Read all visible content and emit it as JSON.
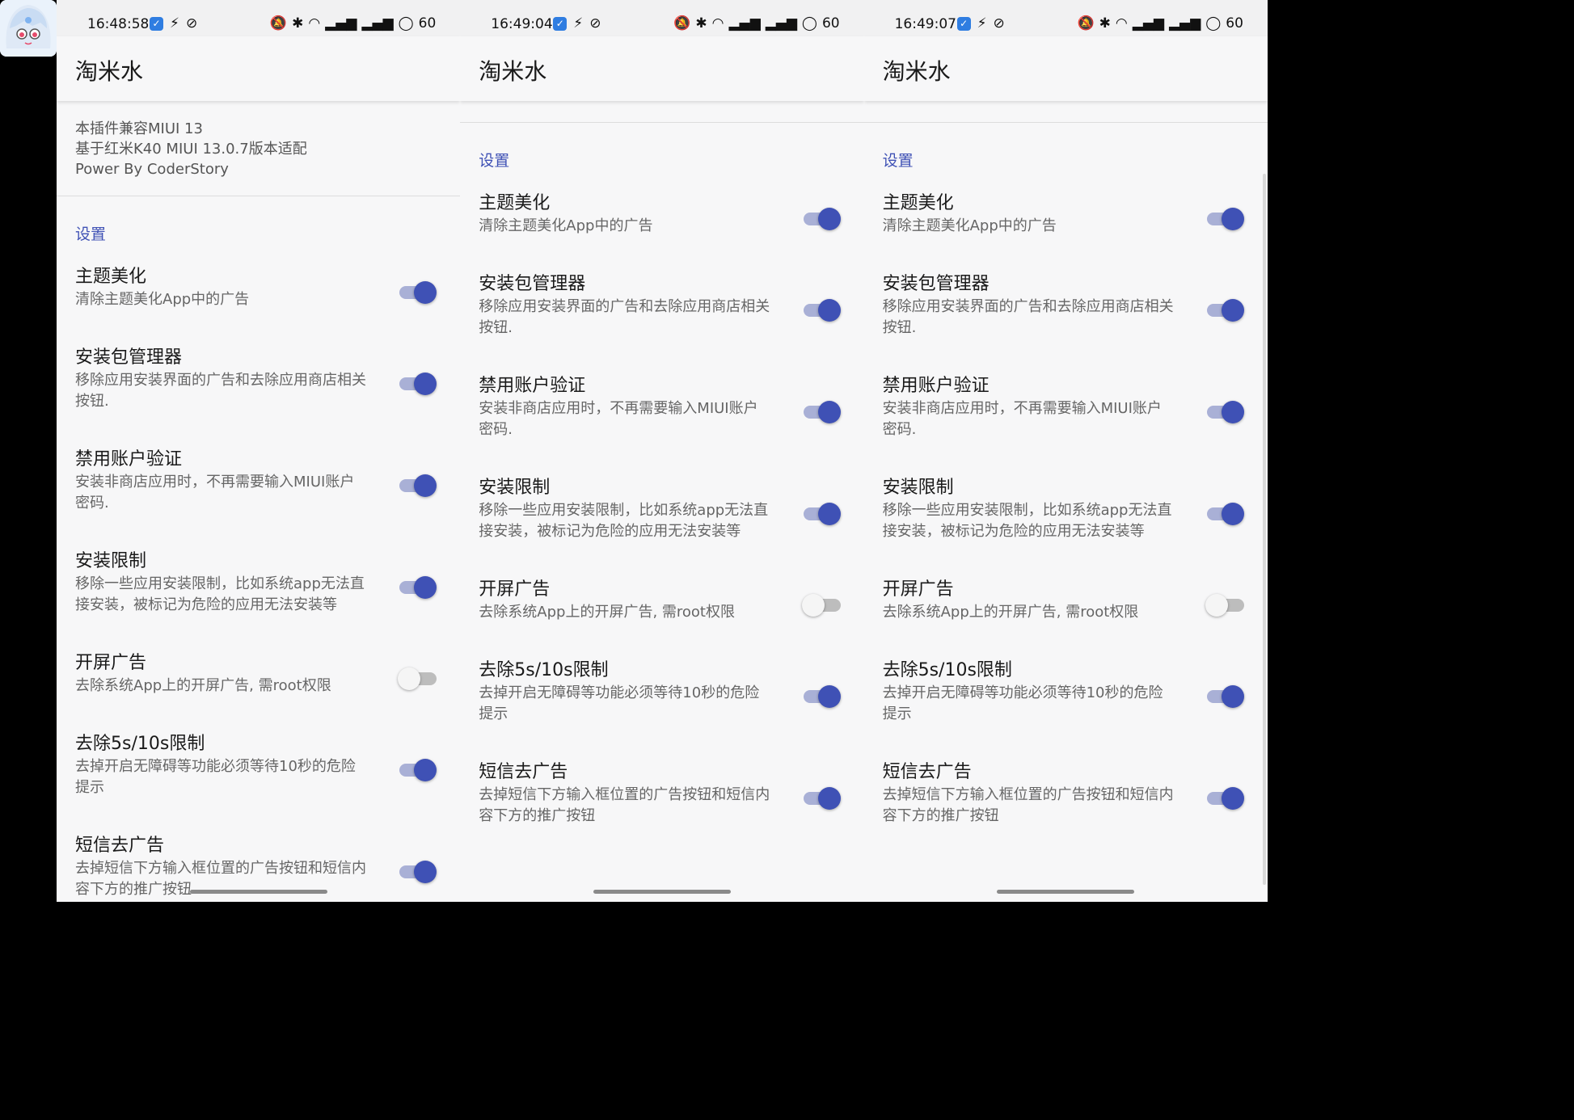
{
  "app_title": "淘米水",
  "status_icons": {
    "battery": "60"
  },
  "info": [
    "本插件兼容MIUI 13",
    "基于红米K40 MIUI 13.0.7版本适配",
    "Power By CoderStory"
  ],
  "section_title": "设置",
  "phones": [
    {
      "time": "16:48:58"
    },
    {
      "time": "16:49:04"
    },
    {
      "time": "16:49:07"
    }
  ],
  "settings": [
    {
      "title": "主题美化",
      "summary": "清除主题美化App中的广告",
      "on": true
    },
    {
      "title": "安装包管理器",
      "summary": "移除应用安装界面的广告和去除应用商店相关按钮.",
      "on": true
    },
    {
      "title": "禁用账户验证",
      "summary": "安装非商店应用时，不再需要输入MIUI账户密码.",
      "on": true
    },
    {
      "title": "安装限制",
      "summary": "移除一些应用安装限制，比如系统app无法直接安装，被标记为危险的应用无法安装等",
      "on": true
    },
    {
      "title": "开屏广告",
      "summary": "去除系统App上的开屏广告, 需root权限",
      "on": false
    },
    {
      "title": "去除5s/10s限制",
      "summary": "去掉开启无障碍等功能必须等待10秒的危险提示",
      "on": true
    },
    {
      "title": "短信去广告",
      "summary": "去掉短信下方输入框位置的广告按钮和短信内容下方的推广按钮",
      "on": true
    }
  ]
}
